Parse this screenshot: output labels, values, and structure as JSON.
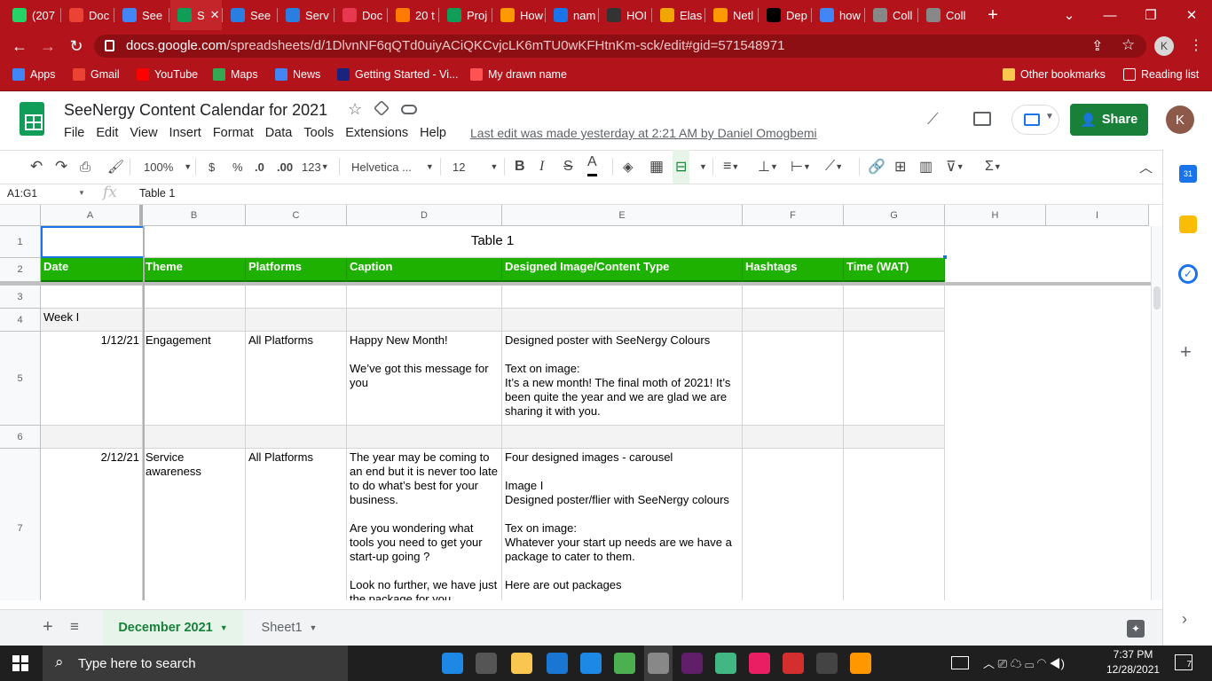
{
  "browser": {
    "tabs": [
      {
        "label": "(207",
        "color": "#25d366"
      },
      {
        "label": "Doc",
        "color": "#ea4335"
      },
      {
        "label": "See",
        "color": "#4285f4"
      },
      {
        "label": "S",
        "color": "#0f9d58"
      },
      {
        "label": "See",
        "color": "#2a7de1"
      },
      {
        "label": "Serv",
        "color": "#2a7de1"
      },
      {
        "label": "Doc",
        "color": "#e8384f"
      },
      {
        "label": "20 t",
        "color": "#ff7a00"
      },
      {
        "label": "Proj",
        "color": "#0f9d58"
      },
      {
        "label": "How",
        "color": "#ff9900"
      },
      {
        "label": "nam",
        "color": "#1a73e8"
      },
      {
        "label": "HOI",
        "color": "#333333"
      },
      {
        "label": "Elas",
        "color": "#f0a500"
      },
      {
        "label": "Netl",
        "color": "#ff9900"
      },
      {
        "label": "Dep",
        "color": "#000000"
      },
      {
        "label": "how",
        "color": "#4285f4"
      },
      {
        "label": "Coll",
        "color": "#888888"
      },
      {
        "label": "Coll",
        "color": "#888888"
      }
    ],
    "url_host": "docs.google.com",
    "url_path": "/spreadsheets/d/1DlvnNF6qQTd0uiyACiQKCvjcLK6mTU0wKFHtnKm-sck/edit#gid=571548971",
    "profile_initial": "K",
    "bookmarks": [
      {
        "label": "Apps",
        "color": "#4285f4"
      },
      {
        "label": "Gmail",
        "color": "#ea4335"
      },
      {
        "label": "YouTube",
        "color": "#ff0000"
      },
      {
        "label": "Maps",
        "color": "#34a853"
      },
      {
        "label": "News",
        "color": "#4285f4"
      },
      {
        "label": "Getting Started - Vi...",
        "color": "#1a237e"
      },
      {
        "label": "My drawn name",
        "color": "#ff5252"
      }
    ],
    "other_bookmarks": "Other bookmarks",
    "reading_list": "Reading list"
  },
  "doc": {
    "title": "SeeNergy Content Calendar for 2021",
    "menu": [
      "File",
      "Edit",
      "View",
      "Insert",
      "Format",
      "Data",
      "Tools",
      "Extensions",
      "Help"
    ],
    "last_edit": "Last edit was made yesterday at 2:21 AM by Daniel Omogbemi",
    "share": "Share",
    "avatar": "K"
  },
  "toolbar": {
    "zoom": "100%",
    "currency": "$",
    "percent": "%",
    "dec_less": ".0",
    "dec_more": ".00",
    "format123": "123",
    "font": "Helvetica ...",
    "size": "12"
  },
  "formula": {
    "name_box": "A1:G1",
    "fx": "fx",
    "value": "Table 1"
  },
  "columns": [
    "A",
    "B",
    "C",
    "D",
    "E",
    "F",
    "G",
    "H",
    "I"
  ],
  "rows": [
    "1",
    "2",
    "3",
    "4",
    "5",
    "6",
    "7"
  ],
  "table": {
    "title": "Table 1",
    "headers": [
      "Date",
      "Theme",
      "Platforms",
      "Caption",
      "Designed Image/Content Type",
      "Hashtags",
      "Time (WAT)"
    ],
    "week": "Week I",
    "r5": {
      "date": "1/12/21",
      "theme": "Engagement",
      "platforms": "All Platforms",
      "caption": "Happy New Month!\n\nWe’ve got this message for you",
      "content": "Designed poster with SeeNergy Colours\n\nText on image:\nIt’s a new month! The final moth of 2021! It’s been quite the year and we are glad we are sharing it with you."
    },
    "r7": {
      "date": "2/12/21",
      "theme": "Service awareness",
      "platforms": "All Platforms",
      "caption": "The year may be coming to an end but it is never too late to do what’s best for your business.\n\nAre you wondering what tools you need to get your start-up going ?\n\nLook no further, we have just the package for you",
      "content": "Four designed images - carousel\n\nImage I\nDesigned poster/flier with SeeNergy colours\n\nTex on image:\nWhatever your start up needs are we have a package to cater to them.\n\nHere are out packages"
    }
  },
  "sheets": [
    "December 2021",
    "Sheet1"
  ],
  "taskbar": {
    "search": "Type here to search",
    "time": "7:37 PM",
    "date": "12/28/2021",
    "notif": "7"
  }
}
